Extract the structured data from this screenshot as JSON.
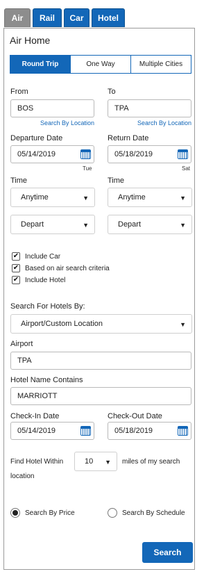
{
  "tabs": [
    "Air",
    "Rail",
    "Car",
    "Hotel"
  ],
  "title": "Air Home",
  "trip_types": [
    "Round Trip",
    "One Way",
    "Multiple Cities"
  ],
  "from": {
    "label": "From",
    "value": "BOS",
    "link": "Search By Location"
  },
  "to": {
    "label": "To",
    "value": "TPA",
    "link": "Search By Location"
  },
  "departure": {
    "label": "Departure Date",
    "value": "05/14/2019",
    "day": "Tue"
  },
  "return": {
    "label": "Return Date",
    "value": "05/18/2019",
    "day": "Sat"
  },
  "time_left": {
    "label": "Time",
    "time": "Anytime",
    "mode": "Depart"
  },
  "time_right": {
    "label": "Time",
    "time": "Anytime",
    "mode": "Depart"
  },
  "checks": [
    {
      "label": "Include Car",
      "checked": true
    },
    {
      "label": "Based on air search criteria",
      "checked": true
    },
    {
      "label": "Include Hotel",
      "checked": true
    }
  ],
  "hotel_by": {
    "label": "Search For Hotels By:",
    "value": "Airport/Custom Location"
  },
  "airport": {
    "label": "Airport",
    "value": "TPA"
  },
  "hotel_name": {
    "label": "Hotel Name Contains",
    "value": "MARRIOTT"
  },
  "checkin": {
    "label": "Check-In Date",
    "value": "05/14/2019"
  },
  "checkout": {
    "label": "Check-Out Date",
    "value": "05/18/2019"
  },
  "within": {
    "prefix": "Find Hotel Within",
    "value": "10",
    "suffix": "miles of my search",
    "suffix2": "location"
  },
  "search_by": [
    {
      "label": "Search By Price",
      "selected": true
    },
    {
      "label": "Search By Schedule",
      "selected": false
    }
  ],
  "search_button": "Search",
  "colors": {
    "accent": "#1367b8",
    "tab_inactive": "#8d8d8d"
  }
}
